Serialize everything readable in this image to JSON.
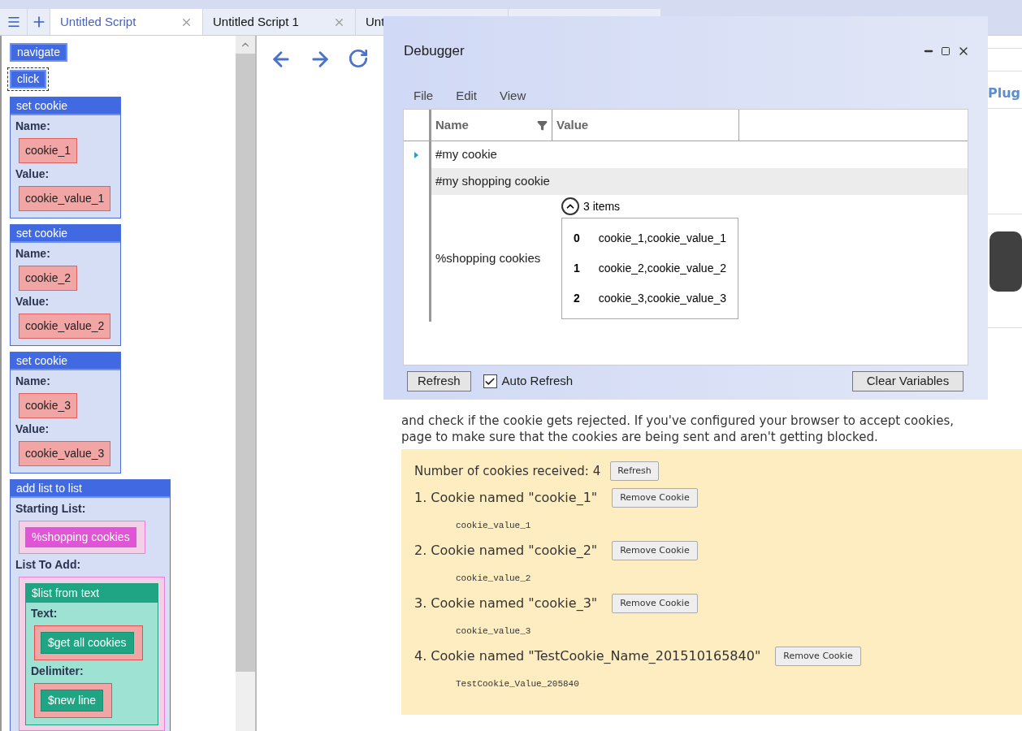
{
  "tabs": [
    {
      "label": "Untitled Script",
      "selected": true
    },
    {
      "label": "Untitled Script 1",
      "selected": false
    },
    {
      "label": "Unt",
      "selected": false
    }
  ],
  "script_blocks": [
    {
      "kind": "command",
      "label": "navigate",
      "selected": false
    },
    {
      "kind": "command",
      "label": "click",
      "selected": true
    },
    {
      "kind": "block",
      "label": "set cookie",
      "fields": [
        {
          "label": "Name:",
          "value": {
            "kind": "text",
            "text": "cookie_1"
          }
        },
        {
          "label": "Value:",
          "value": {
            "kind": "text",
            "text": "cookie_value_1"
          }
        }
      ]
    },
    {
      "kind": "block",
      "label": "set cookie",
      "fields": [
        {
          "label": "Name:",
          "value": {
            "kind": "text",
            "text": "cookie_2"
          }
        },
        {
          "label": "Value:",
          "value": {
            "kind": "text",
            "text": "cookie_value_2"
          }
        }
      ]
    },
    {
      "kind": "block",
      "label": "set cookie",
      "fields": [
        {
          "label": "Name:",
          "value": {
            "kind": "text",
            "text": "cookie_3"
          }
        },
        {
          "label": "Value:",
          "value": {
            "kind": "text",
            "text": "cookie_value_3"
          }
        }
      ]
    },
    {
      "kind": "block",
      "label": "add list to list",
      "fields": [
        {
          "label": "Starting List:",
          "value": {
            "kind": "list_variable",
            "text": "%shopping cookies"
          }
        },
        {
          "label": "List To Add:",
          "value": {
            "kind": "function_block",
            "title": "$list from text",
            "fields": [
              {
                "label": "Text:",
                "value": {
                  "kind": "function",
                  "text": "$get all cookies"
                }
              },
              {
                "label": "Delimiter:",
                "value": {
                  "kind": "function",
                  "text": "$new line"
                }
              }
            ]
          }
        }
      ]
    }
  ],
  "page": {
    "heading": "Plug",
    "paragraph": [
      "and check if the cookie gets rejected. If you've configured your browser to accept cookies,",
      "page to make sure that the cookies are being sent and aren't getting blocked."
    ],
    "cookie_panel": {
      "count_text": "Number of cookies received: 4",
      "refresh": "Refresh",
      "cookies": [
        {
          "label": "1. Cookie named \"cookie_1\"",
          "button": "Remove Cookie",
          "value": "cookie_value_1"
        },
        {
          "label": "2. Cookie named \"cookie_2\"",
          "button": "Remove Cookie",
          "value": "cookie_value_2"
        },
        {
          "label": "3. Cookie named \"cookie_3\"",
          "button": "Remove Cookie",
          "value": "cookie_value_3"
        },
        {
          "label": "4. Cookie named \"TestCookie_Name_201510165840\"",
          "button": "Remove Cookie",
          "value": "TestCookie_Value_205840"
        }
      ]
    }
  },
  "debugger": {
    "title": "Debugger",
    "menu": [
      "File",
      "Edit",
      "View"
    ],
    "columns": [
      {
        "label": "Name",
        "filter": true
      },
      {
        "label": "Value",
        "filter": false
      }
    ],
    "rows": [
      {
        "name": "#my cookie",
        "current": true,
        "selected": false
      },
      {
        "name": "#my shopping cookie",
        "current": false,
        "selected": true
      },
      {
        "name": "%shopping cookies",
        "current": false,
        "selected": false,
        "expanded": true,
        "count": "3 items",
        "items": [
          {
            "index": "0",
            "value": "cookie_1,cookie_value_1"
          },
          {
            "index": "1",
            "value": "cookie_2,cookie_value_2"
          },
          {
            "index": "2",
            "value": "cookie_3,cookie_value_3"
          }
        ]
      }
    ],
    "refresh": "Refresh",
    "auto_refresh": {
      "label": "Auto Refresh",
      "checked": true
    },
    "clear": "Clear Variables"
  }
}
